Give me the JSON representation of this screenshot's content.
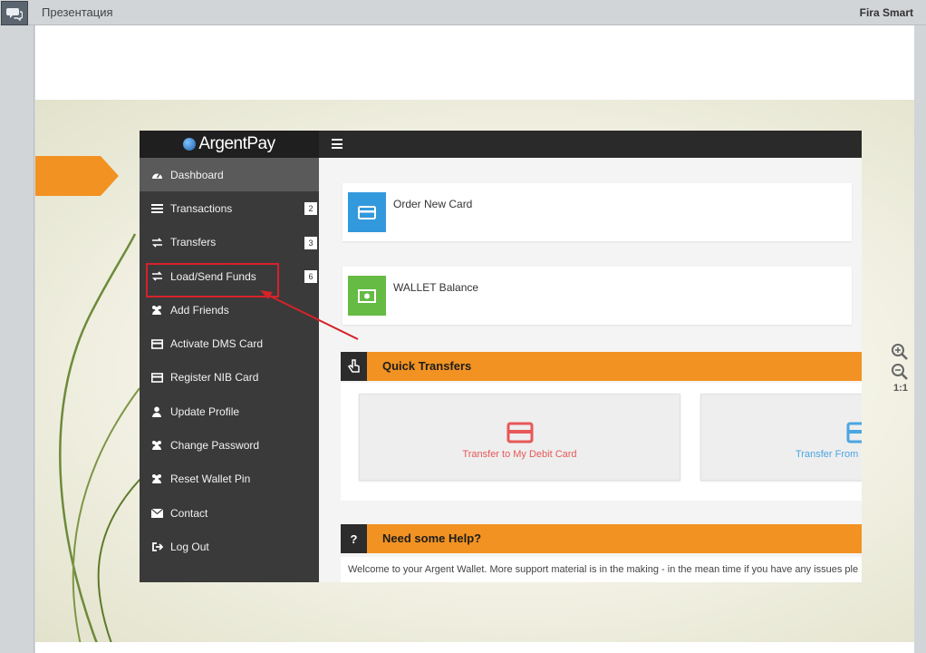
{
  "window": {
    "title": "Презентация",
    "brand": "Fira Smart"
  },
  "zoom": {
    "ratio_label": "1:1"
  },
  "app": {
    "logo": "ArgentPay",
    "sidebar": [
      {
        "label": "Dashboard",
        "icon": "dashboard-icon",
        "active": true
      },
      {
        "label": "Transactions",
        "icon": "list-icon",
        "badge": "2"
      },
      {
        "label": "Transfers",
        "icon": "exchange-icon",
        "badge": "3"
      },
      {
        "label": "Load/Send Funds",
        "icon": "exchange-icon",
        "badge": "6"
      },
      {
        "label": "Add Friends",
        "icon": "users-icon"
      },
      {
        "label": "Activate DMS Card",
        "icon": "card-icon"
      },
      {
        "label": "Register NIB Card",
        "icon": "card-icon"
      },
      {
        "label": "Update Profile",
        "icon": "user-icon"
      },
      {
        "label": "Change Password",
        "icon": "users-icon"
      },
      {
        "label": "Reset Wallet Pin",
        "icon": "users-icon"
      },
      {
        "label": "Contact",
        "icon": "envelope-icon"
      },
      {
        "label": "Log Out",
        "icon": "logout-icon"
      }
    ],
    "cards": {
      "order_card": "Order New Card",
      "wallet_balance": "WALLET Balance"
    },
    "quick_transfers": {
      "title": "Quick Transfers",
      "tile1": "Transfer to My Debit Card",
      "tile2": "Transfer From"
    },
    "help": {
      "icon_label": "?",
      "title": "Need some Help?",
      "text": "Welcome to your Argent Wallet. More support material is in the making - in the mean time if you have any issues ple"
    }
  },
  "colors": {
    "accent": "#f29222",
    "sidebar": "#3a3a3a",
    "highlight": "#d6222a",
    "card_blue": "#3399dd",
    "card_green": "#66bb44",
    "tile_red": "#e85858",
    "tile_blue": "#4aa6e0"
  }
}
